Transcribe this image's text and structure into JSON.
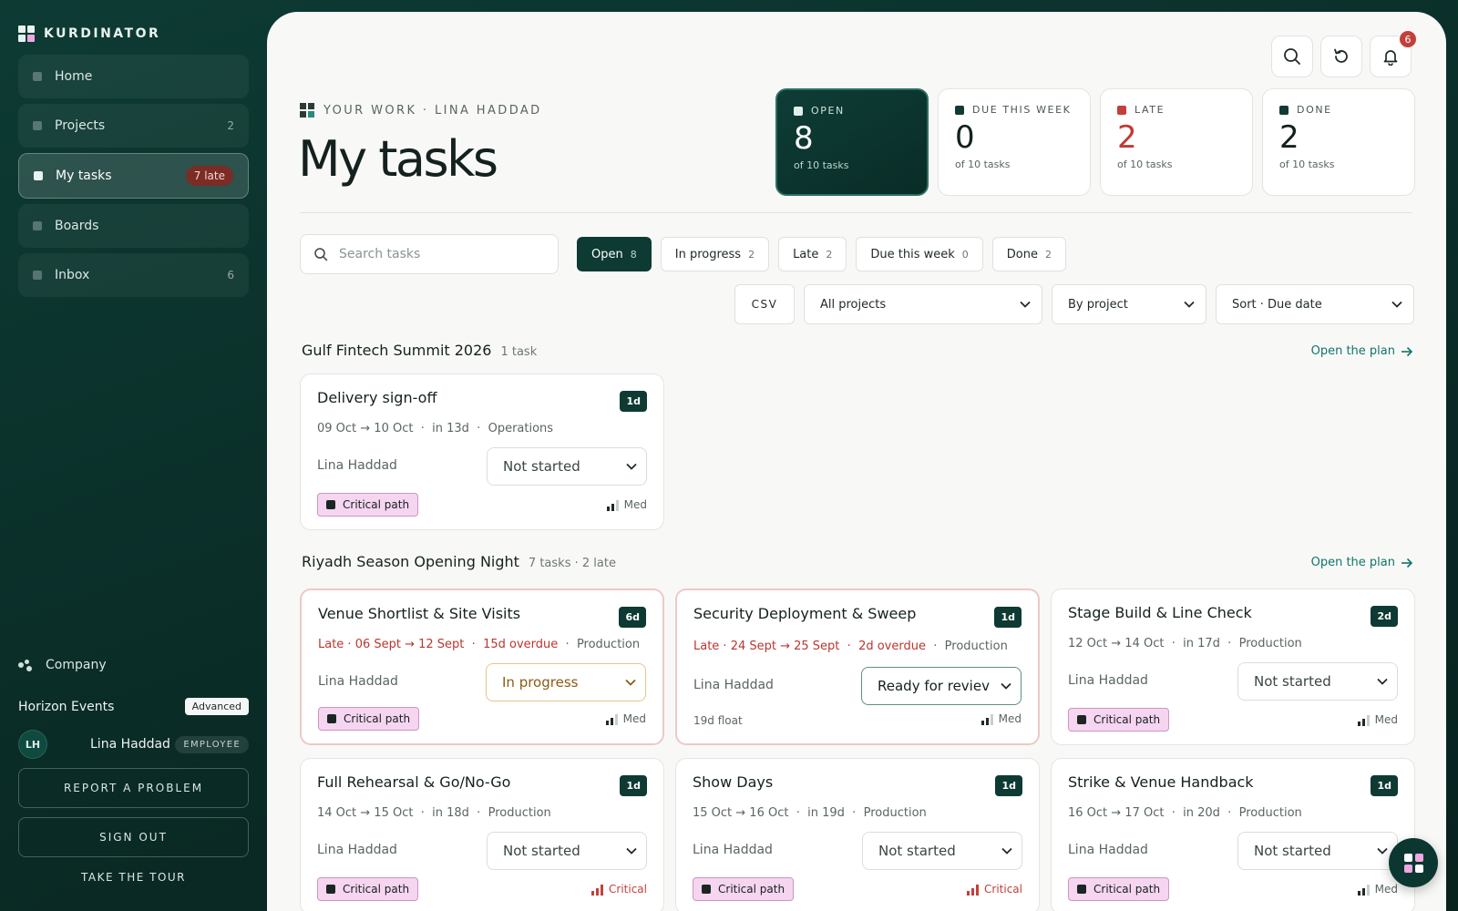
{
  "app": {
    "brand": "KURDINATOR"
  },
  "sidebar": {
    "items": [
      {
        "label": "Home",
        "count": ""
      },
      {
        "label": "Projects",
        "count": "2"
      },
      {
        "label": "My tasks",
        "badge": "7 late"
      },
      {
        "label": "Boards",
        "count": ""
      },
      {
        "label": "Inbox",
        "count": "6"
      }
    ],
    "company_label": "Company",
    "org_name": "Horizon Events",
    "org_tier": "Advanced",
    "user": {
      "initials": "LH",
      "name": "Lina Haddad",
      "role": "EMPLOYEE"
    },
    "report_label": "REPORT A PROBLEM",
    "signout_label": "SIGN OUT",
    "tour_label": "TAKE THE TOUR"
  },
  "header": {
    "eyebrow": "YOUR WORK · LINA HADDAD",
    "title": "My tasks",
    "notifications": "6"
  },
  "stats": [
    {
      "label": "OPEN",
      "value": "8",
      "sub": "of 10 tasks"
    },
    {
      "label": "DUE THIS WEEK",
      "value": "0",
      "sub": "of 10 tasks"
    },
    {
      "label": "LATE",
      "value": "2",
      "sub": "of 10 tasks"
    },
    {
      "label": "DONE",
      "value": "2",
      "sub": "of 10 tasks"
    }
  ],
  "filters": {
    "search_placeholder": "Search tasks",
    "chips": [
      {
        "label": "Open",
        "count": "8"
      },
      {
        "label": "In progress",
        "count": "2"
      },
      {
        "label": "Late",
        "count": "2"
      },
      {
        "label": "Due this week",
        "count": "0"
      },
      {
        "label": "Done",
        "count": "2"
      }
    ],
    "csv_label": "CSV",
    "project_select": "All projects",
    "group_select": "By project",
    "sort_select": "Sort · Due date"
  },
  "groups": [
    {
      "title": "Gulf Fintech Summit 2026",
      "meta": "1 task",
      "link": "Open the plan",
      "tasks": [
        {
          "title": "Delivery sign-off",
          "duration": "1d",
          "dates": "09 Oct → 10 Oct",
          "when": "in 13d",
          "team": "Operations",
          "assignee": "Lina Haddad",
          "status": "Not started",
          "tag": "Critical path",
          "priority": "Med"
        }
      ]
    },
    {
      "title": "Riyadh Season Opening Night",
      "meta": "7 tasks · 2 late",
      "link": "Open the plan",
      "tasks": [
        {
          "title": "Venue Shortlist & Site Visits",
          "duration": "6d",
          "late_dates": "Late · 06 Sept → 12 Sept",
          "overdue": "15d overdue",
          "team": "Production",
          "assignee": "Lina Haddad",
          "status": "In progress",
          "tag": "Critical path",
          "priority": "Med"
        },
        {
          "title": "Security Deployment & Sweep",
          "duration": "1d",
          "late_dates": "Late · 24 Sept → 25 Sept",
          "overdue": "2d overdue",
          "team": "Production",
          "assignee": "Lina Haddad",
          "status": "Ready for reviev",
          "float": "19d float",
          "priority": "Med"
        },
        {
          "title": "Stage Build & Line Check",
          "duration": "2d",
          "dates": "12 Oct → 14 Oct",
          "when": "in 17d",
          "team": "Production",
          "assignee": "Lina Haddad",
          "status": "Not started",
          "tag": "Critical path",
          "priority": "Med"
        },
        {
          "title": "Full Rehearsal & Go/No-Go",
          "duration": "1d",
          "dates": "14 Oct → 15 Oct",
          "when": "in 18d",
          "team": "Production",
          "assignee": "Lina Haddad",
          "status": "Not started",
          "tag": "Critical path",
          "priority": "Critical"
        },
        {
          "title": "Show Days",
          "duration": "1d",
          "dates": "15 Oct → 16 Oct",
          "when": "in 19d",
          "team": "Production",
          "assignee": "Lina Haddad",
          "status": "Not started",
          "tag": "Critical path",
          "priority": "Critical"
        },
        {
          "title": "Strike & Venue Handback",
          "duration": "1d",
          "dates": "16 Oct → 17 Oct",
          "when": "in 20d",
          "team": "Production",
          "assignee": "Lina Haddad",
          "status": "Not started",
          "tag": "Critical path",
          "priority": "Med"
        }
      ]
    }
  ],
  "colors": {
    "accent_dark": "#0d3a33",
    "late": "#bf3b33",
    "critical_tag_bg": "#f6d5f1",
    "link": "#12746a"
  }
}
